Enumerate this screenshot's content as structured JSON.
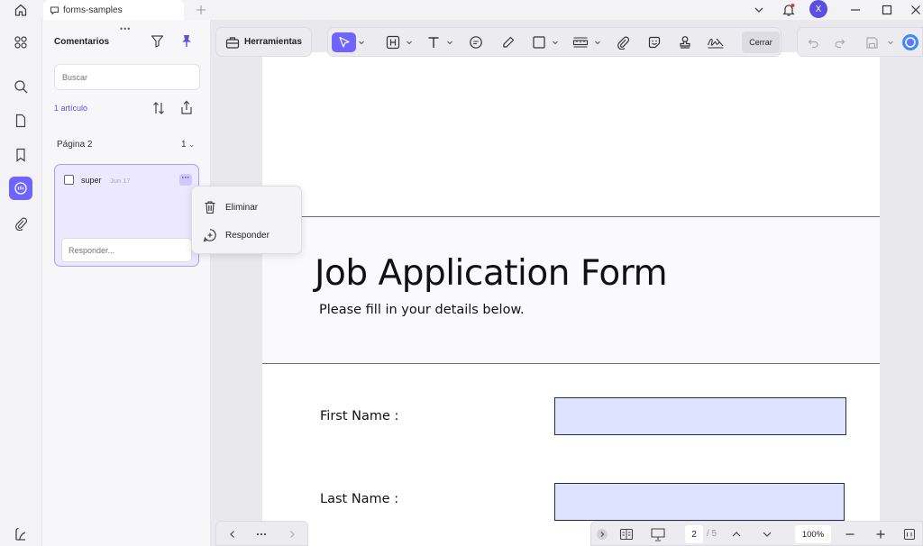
{
  "titlebar": {
    "tab_label": "forms-samples",
    "avatar_letter": "X"
  },
  "panel": {
    "title": "Comentarios",
    "search_placeholder": "Buscar",
    "count": "1 artículo",
    "page_label": "Página 2",
    "page_count": "1",
    "comment": {
      "author": "super",
      "date": "Jun 17",
      "reply_placeholder": "Responder..."
    }
  },
  "context_menu": {
    "items": [
      "Eliminar",
      "Responder"
    ]
  },
  "toolbar": {
    "tools_label": "Herramientas",
    "close_label": "Cerrar"
  },
  "document": {
    "title": "Job Application Form",
    "subtitle": "Please fill in your details below.",
    "fields": [
      "First Name :",
      "Last Name :"
    ]
  },
  "pager": {
    "current_page": "2",
    "total": "/ 5",
    "zoom": "100%"
  },
  "colors": {
    "accent": "#6f64ff",
    "field_fill": "#dde3ff"
  }
}
